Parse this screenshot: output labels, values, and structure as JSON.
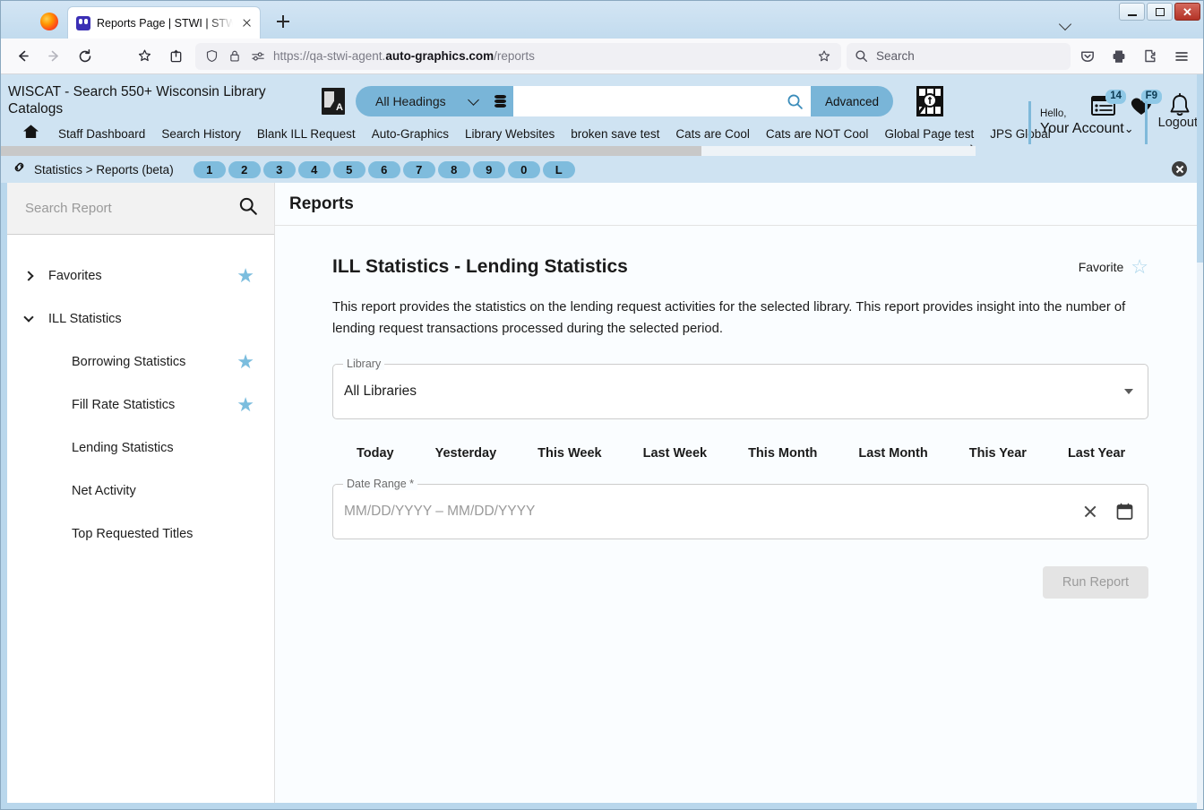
{
  "browser": {
    "tab": {
      "title": "Reports Page | STWI | STWI | Au",
      "favicon": "stwi-favicon"
    },
    "newtab_label": "+",
    "url": {
      "prefix": "https://qa-stwi-agent.",
      "domain": "auto-graphics.com",
      "path": "/reports"
    },
    "search_placeholder": "Search",
    "window_controls": {
      "minimize": "–",
      "maximize": "❐",
      "close": "✕"
    }
  },
  "app_header": {
    "site_title": "WISCAT - Search 550+ Wisconsin Library Catalogs",
    "search": {
      "scope_label": "All Headings",
      "query_value": "",
      "advanced_label": "Advanced"
    },
    "icons": {
      "lists_badge": "14",
      "favorites_badge": "F9"
    },
    "account": {
      "hello": "Hello,",
      "name": "Your Account",
      "logout": "Logout"
    }
  },
  "nav_menu": {
    "items": [
      "Staff Dashboard",
      "Search History",
      "Blank ILL Request",
      "Auto-Graphics",
      "Library Websites",
      "broken save test",
      "Cats are Cool",
      "Cats are NOT Cool",
      "Global Page test",
      "JPS Global"
    ],
    "more_arrow": "›"
  },
  "breadcrumb": {
    "text": "Statistics > Reports (beta)",
    "pills": [
      "1",
      "2",
      "3",
      "4",
      "5",
      "6",
      "7",
      "8",
      "9",
      "0",
      "L"
    ]
  },
  "sidebar": {
    "search_placeholder": "Search Report",
    "tree": [
      {
        "label": "Favorites",
        "expander": "collapsed",
        "starred": true,
        "child": false
      },
      {
        "label": "ILL Statistics",
        "expander": "expanded",
        "starred": false,
        "child": false
      },
      {
        "label": "Borrowing Statistics",
        "expander": "none",
        "starred": true,
        "child": true
      },
      {
        "label": "Fill Rate Statistics",
        "expander": "none",
        "starred": true,
        "child": true
      },
      {
        "label": "Lending Statistics",
        "expander": "none",
        "starred": false,
        "child": true
      },
      {
        "label": "Net Activity",
        "expander": "none",
        "starred": false,
        "child": true
      },
      {
        "label": "Top Requested Titles",
        "expander": "none",
        "starred": false,
        "child": true
      }
    ]
  },
  "content": {
    "page_title": "Reports",
    "report_title": "ILL Statistics - Lending Statistics",
    "favorite_label": "Favorite",
    "description": "This report provides the statistics on the lending request activities for the selected library. This report provides insight into the number of lending request transactions processed during the selected period.",
    "library_field": {
      "legend": "Library",
      "value": "All Libraries"
    },
    "quick_ranges": [
      "Today",
      "Yesterday",
      "This Week",
      "Last Week",
      "This Month",
      "Last Month",
      "This Year",
      "Last Year"
    ],
    "date_field": {
      "legend": "Date Range *",
      "placeholder": "MM/DD/YYYY – MM/DD/YYYY",
      "value": ""
    },
    "run_button": "Run Report"
  },
  "colors": {
    "header_blue": "#cfe3f2",
    "accent_blue": "#79b5d8",
    "pill_blue": "#7fbcdd",
    "star_blue": "#7bbdde",
    "frame_blue": "#b9d7ec"
  }
}
